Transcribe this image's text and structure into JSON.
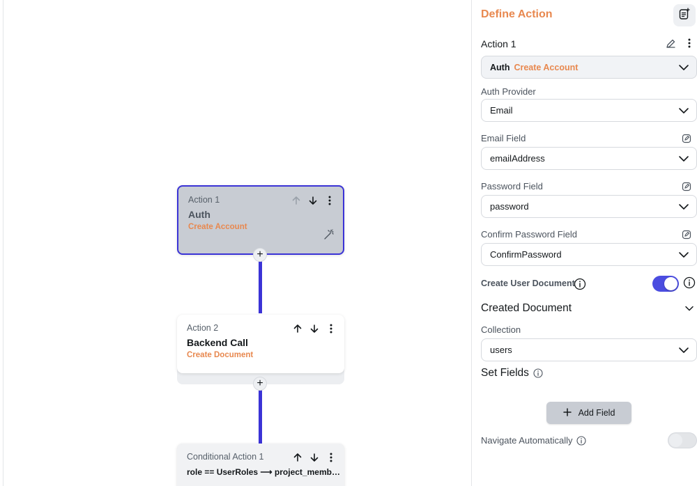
{
  "canvas": {
    "nodes": [
      {
        "label": "Action 1",
        "title": "Auth",
        "subtitle": "Create Account",
        "selected": true
      },
      {
        "label": "Action 2",
        "title": "Backend Call",
        "subtitle": "Create Document",
        "selected": false
      },
      {
        "label": "Conditional Action 1",
        "rule": "role == UserRoles ⟶ project_memb…"
      }
    ],
    "add_symbol": "+"
  },
  "panel": {
    "title": "Define Action",
    "action_name": "Action 1",
    "action_type": {
      "prefix": "Auth",
      "value": "Create Account"
    },
    "auth_provider": {
      "label": "Auth Provider",
      "value": "Email"
    },
    "email_field": {
      "label": "Email Field",
      "value": "emailAddress"
    },
    "password_field": {
      "label": "Password Field",
      "value": "password"
    },
    "confirm_password_field": {
      "label": "Confirm Password Field",
      "value": "ConfirmPassword"
    },
    "create_user_document": {
      "label": "Create User Document",
      "enabled": true
    },
    "created_document": {
      "title": "Created Document"
    },
    "collection": {
      "label": "Collection",
      "value": "users"
    },
    "set_fields": {
      "title": "Set Fields",
      "add_label": "Add Field"
    },
    "navigate_automatically": {
      "label": "Navigate Automatically",
      "enabled": false
    }
  },
  "colors": {
    "accent_orange": "#e8884f",
    "connector_blue": "#3b33d6",
    "toggle_on": "#4b4de0",
    "toggle_off": "#e3e5e8"
  },
  "icons": [
    "arrow-up-icon",
    "arrow-down-icon",
    "more-vertical-icon",
    "magic-wand-icon",
    "plus-icon",
    "edit-icon",
    "edit-square-icon",
    "chevron-down-icon",
    "info-icon",
    "add-note-icon"
  ]
}
